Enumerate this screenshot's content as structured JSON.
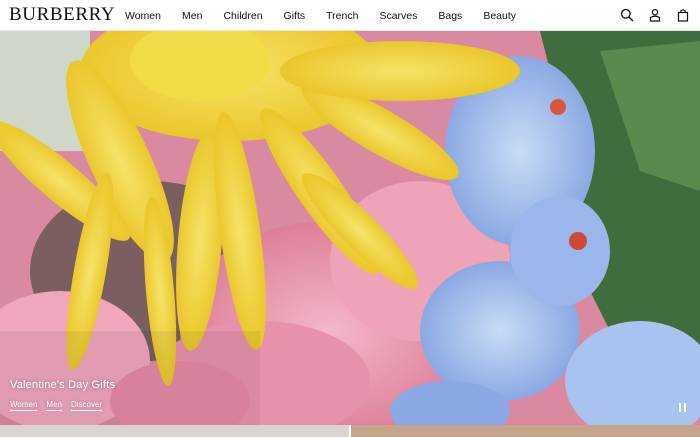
{
  "brand": {
    "logo_text": "BURBERRY"
  },
  "nav": {
    "items": [
      {
        "label": "Women"
      },
      {
        "label": "Men"
      },
      {
        "label": "Children"
      },
      {
        "label": "Gifts"
      },
      {
        "label": "Trench"
      },
      {
        "label": "Scarves"
      },
      {
        "label": "Bags"
      },
      {
        "label": "Beauty"
      }
    ]
  },
  "header_icons": [
    "search-icon",
    "account-icon",
    "bag-icon"
  ],
  "hero": {
    "title": "Valentine's Day Gifts",
    "links": [
      {
        "label": "Women"
      },
      {
        "label": "Men"
      },
      {
        "label": "Discover"
      }
    ],
    "control": "pause-icon"
  },
  "colors": {
    "header_bg": "#ffffff",
    "text": "#111111",
    "hero_yellow": "#f2d53a",
    "hero_pink": "#e89ab0",
    "hero_blue": "#8fb0e8",
    "hero_green": "#3d6b3a"
  }
}
